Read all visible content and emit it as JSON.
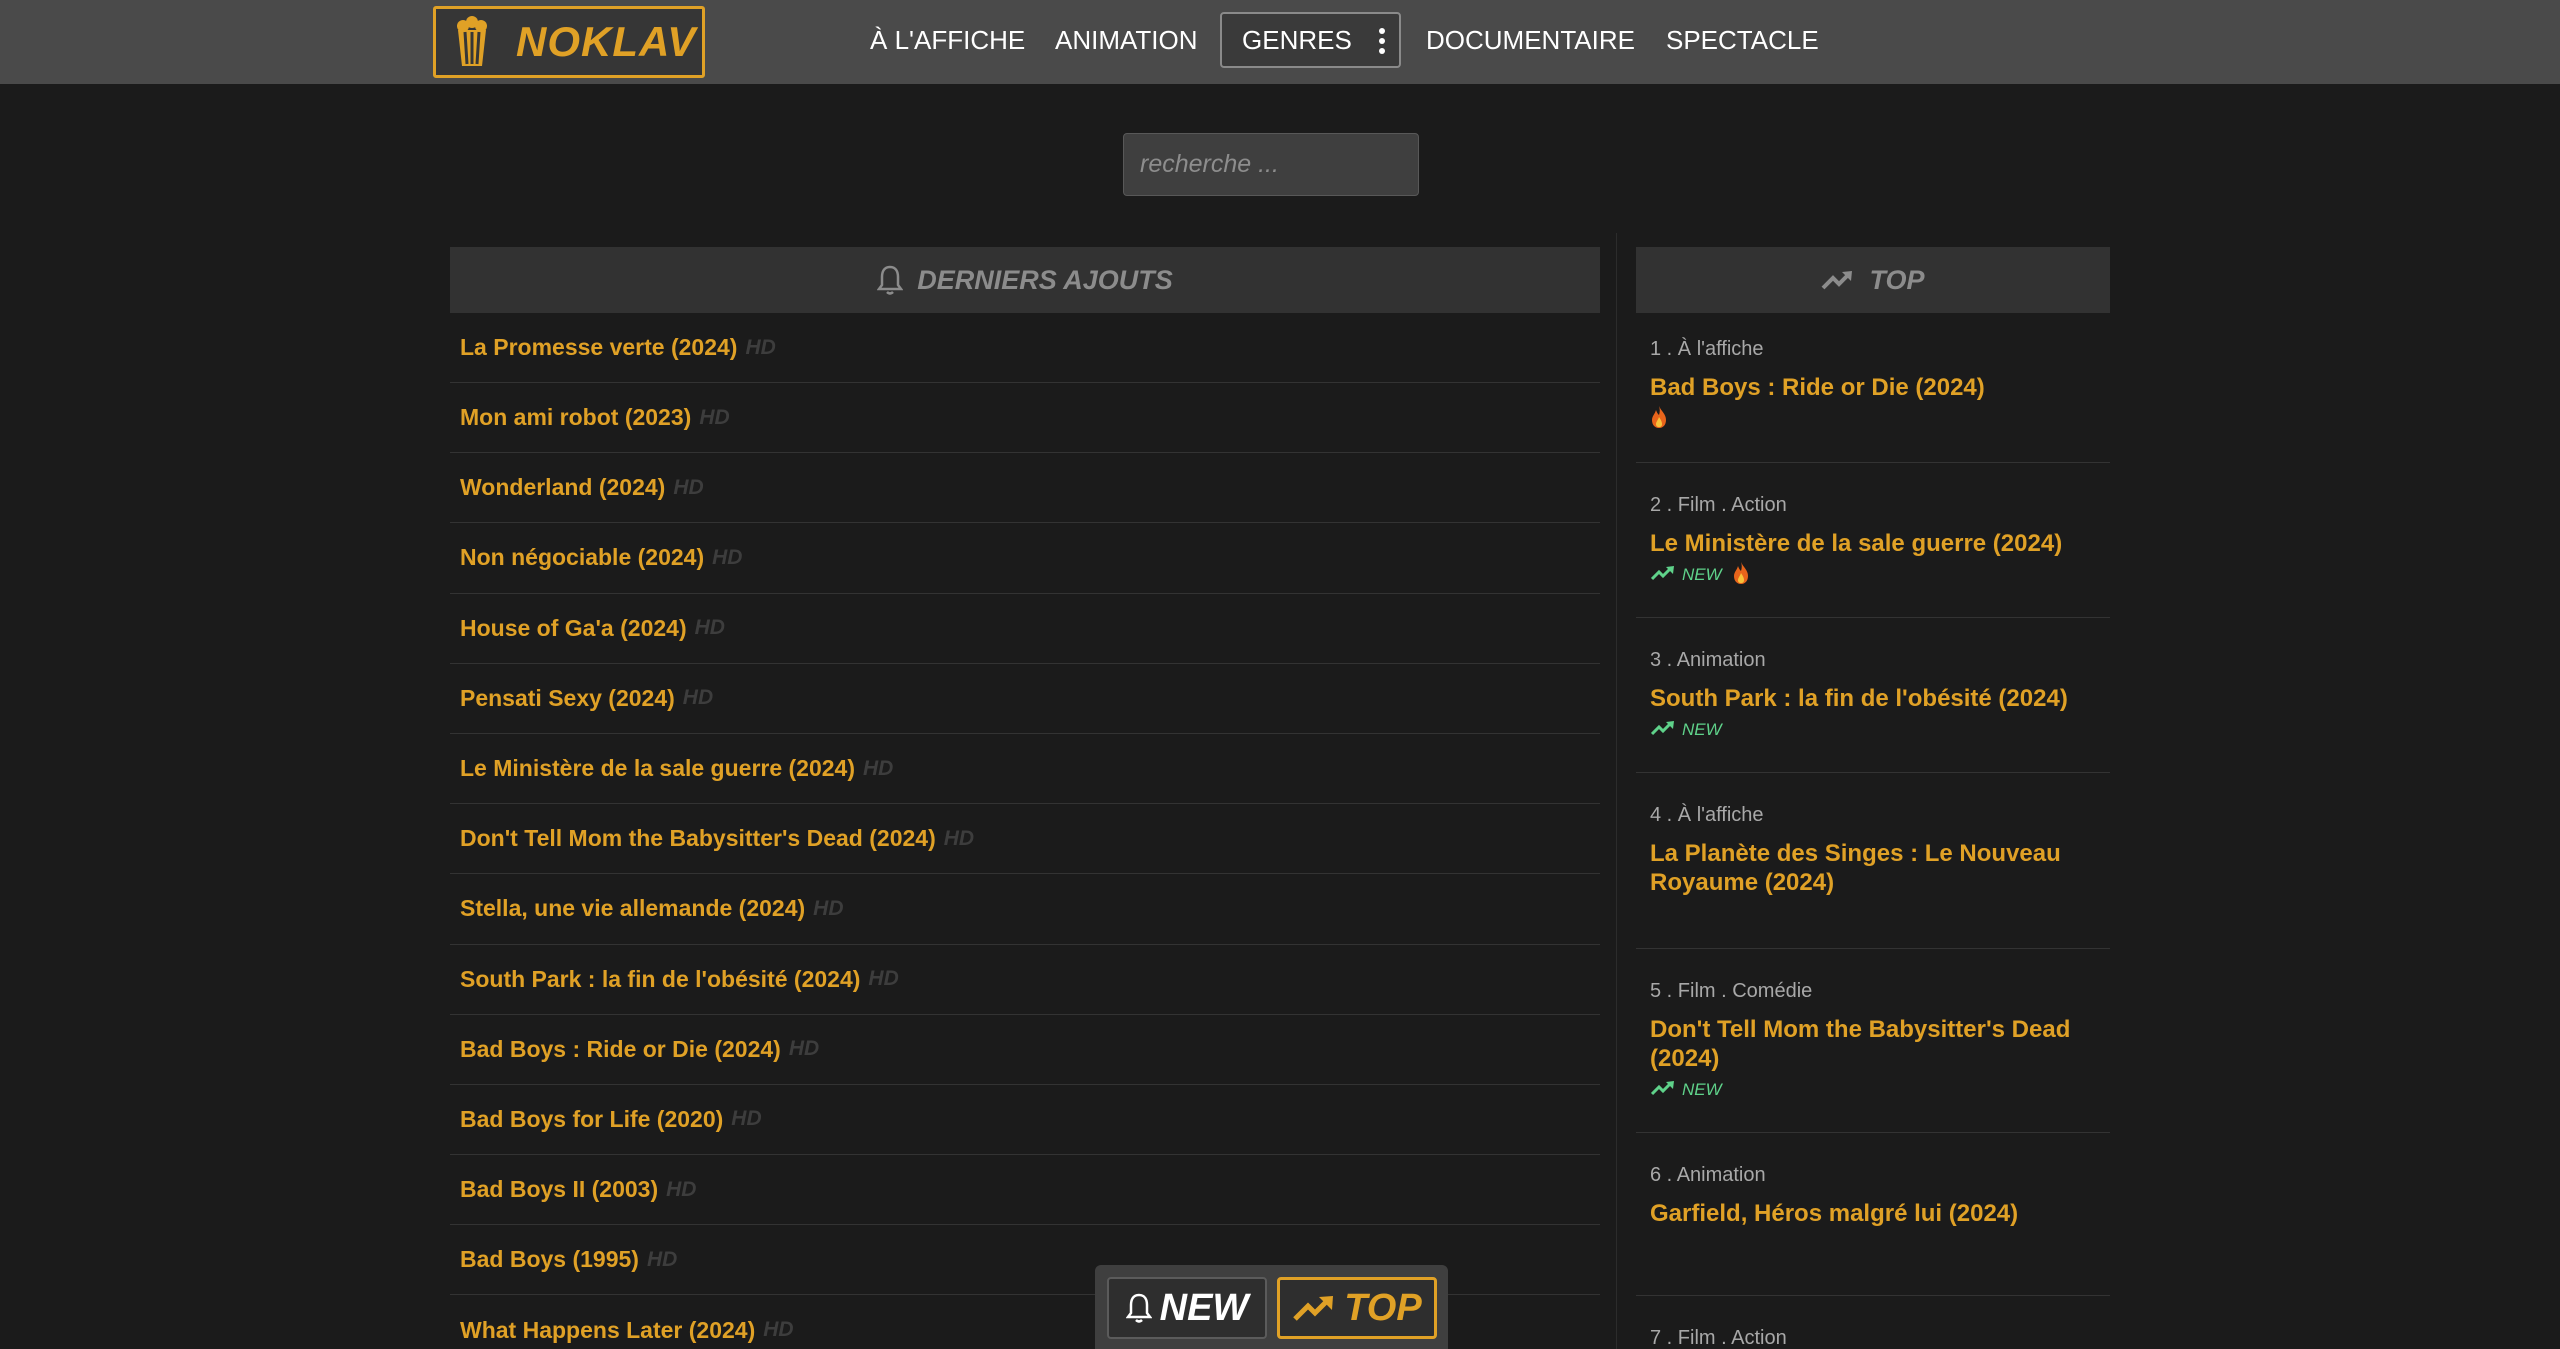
{
  "brand": {
    "name": "NOKLAV"
  },
  "nav": {
    "items": [
      "À L'AFFICHE",
      "ANIMATION"
    ],
    "genres_label": "GENRES",
    "items_right": [
      "DOCUMENTAIRE",
      "SPECTACLE"
    ]
  },
  "search": {
    "placeholder": "recherche ..."
  },
  "latest": {
    "header": "DERNIERS AJOUTS",
    "hd_label": "HD",
    "items": [
      "La Promesse verte (2024)",
      "Mon ami robot (2023)",
      "Wonderland (2024)",
      "Non négociable (2024)",
      "House of Ga'a (2024)",
      "Pensati Sexy (2024)",
      "Le Ministère de la sale guerre (2024)",
      "Don't Tell Mom the Babysitter's Dead (2024)",
      "Stella, une vie allemande (2024)",
      "South Park : la fin de l'obésité (2024)",
      "Bad Boys : Ride or Die (2024)",
      "Bad Boys for Life (2020)",
      "Bad Boys II (2003)",
      "Bad Boys (1995)",
      "What Happens Later (2024)"
    ]
  },
  "top": {
    "header": "TOP",
    "new_label": "NEW",
    "items": [
      {
        "meta": "1 . À l'affiche",
        "title": "Bad Boys : Ride or Die (2024)",
        "new": false,
        "hot": true
      },
      {
        "meta": "2 . Film . Action",
        "title": "Le Ministère de la sale guerre (2024)",
        "new": true,
        "hot": true
      },
      {
        "meta": "3 . Animation",
        "title": "South Park : la fin de l'obésité (2024)",
        "new": true,
        "hot": false
      },
      {
        "meta": "4 . À l'affiche",
        "title": "La Planète des Singes : Le Nouveau Royaume (2024)",
        "new": false,
        "hot": false
      },
      {
        "meta": "5 . Film . Comédie",
        "title": "Don't Tell Mom the Babysitter's Dead (2024)",
        "new": true,
        "hot": false
      },
      {
        "meta": "6 . Animation",
        "title": "Garfield, Héros malgré lui (2024)",
        "new": false,
        "hot": false
      },
      {
        "meta": "7 . Film . Action",
        "title": "",
        "new": false,
        "hot": false
      }
    ]
  },
  "floating": {
    "new_label": "NEW",
    "top_label": "TOP"
  },
  "colors": {
    "accent": "#e0a126",
    "new_green": "#5fd28a",
    "background": "#1b1b1b",
    "topbar": "#4a4a4a"
  }
}
